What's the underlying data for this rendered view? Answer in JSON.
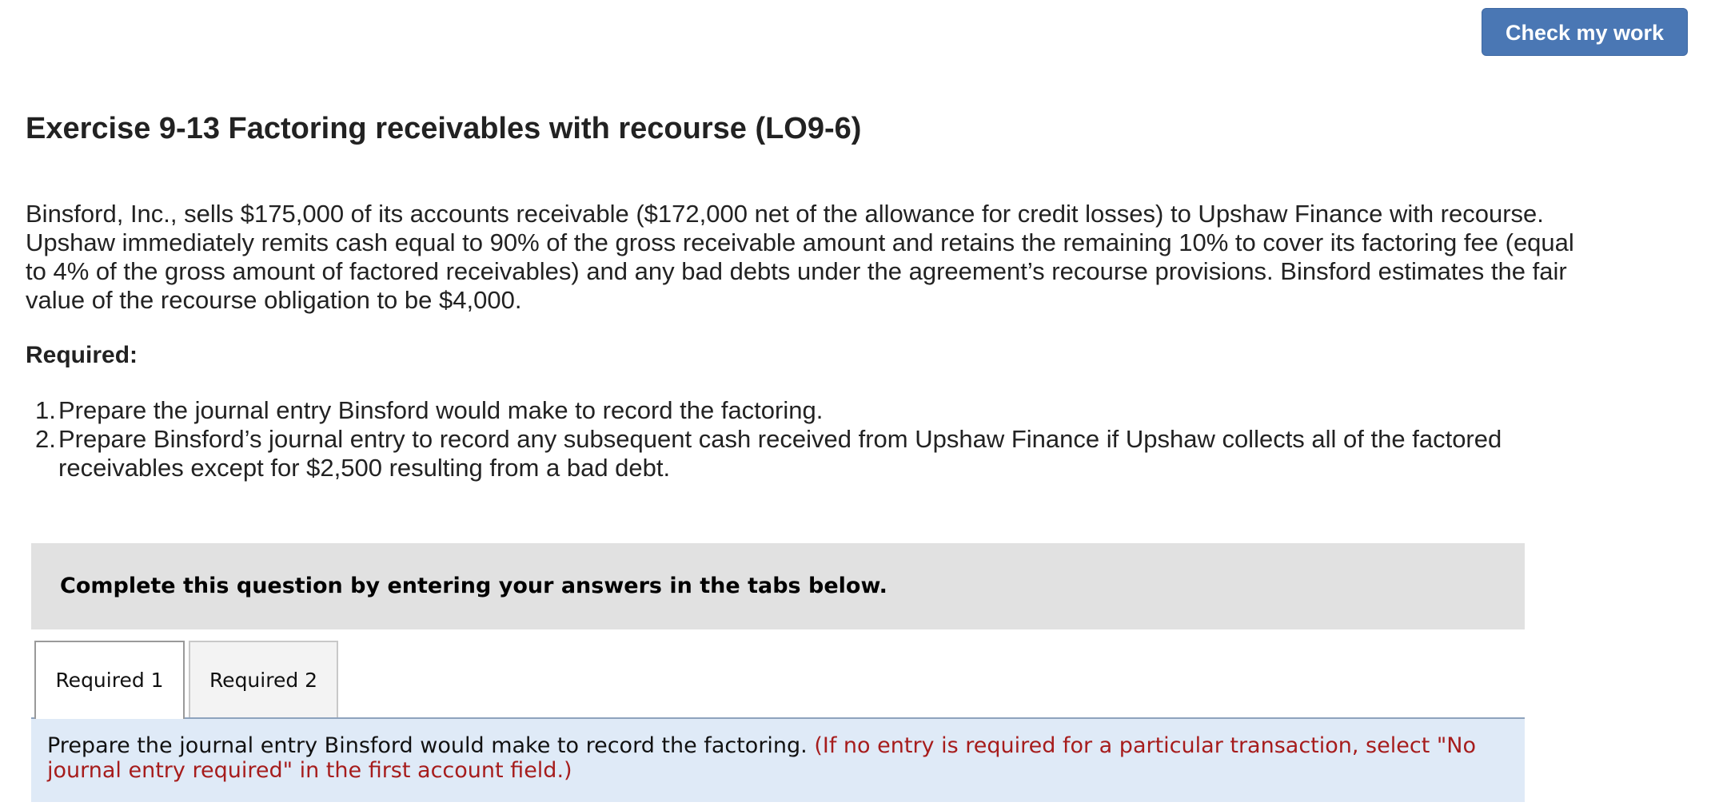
{
  "header": {
    "check_button_label": "Check my work"
  },
  "exercise": {
    "title": "Exercise 9-13 Factoring receivables with recourse (LO9-6)",
    "problem_text": "Binsford, Inc., sells $175,000 of its accounts receivable ($172,000 net of the allowance for credit losses) to Upshaw Finance with recourse. Upshaw immediately remits cash equal to 90% of the gross receivable amount and retains the remaining 10% to cover its factoring fee (equal to 4% of the gross amount of factored receivables) and any bad debts under the agreement’s recourse provisions. Binsford estimates the fair value of the recourse obligation to be $4,000.",
    "required_heading": "Required:",
    "requirements": [
      {
        "number": "1.",
        "text": "Prepare the journal entry Binsford would make to record the factoring."
      },
      {
        "number": "2.",
        "text": "Prepare Binsford’s journal entry to record any subsequent cash received from Upshaw Finance if Upshaw collects all of the factored receivables except for $2,500 resulting from a bad debt."
      }
    ]
  },
  "instructions": {
    "text": "Complete this question by entering your answers in the tabs below."
  },
  "tabs": [
    {
      "label": "Required 1",
      "active": true
    },
    {
      "label": "Required 2",
      "active": false
    }
  ],
  "prompt": {
    "text": "Prepare the journal entry Binsford would make to record the factoring.",
    "note": "(If no entry is required for a particular transaction, select \"No journal entry required\" in the first account field.)",
    "note_color": "#a61c1c"
  },
  "colors": {
    "button": "#4a77b4",
    "instruction_bg": "#e1e1e1",
    "prompt_bg": "#dfeaf7"
  }
}
